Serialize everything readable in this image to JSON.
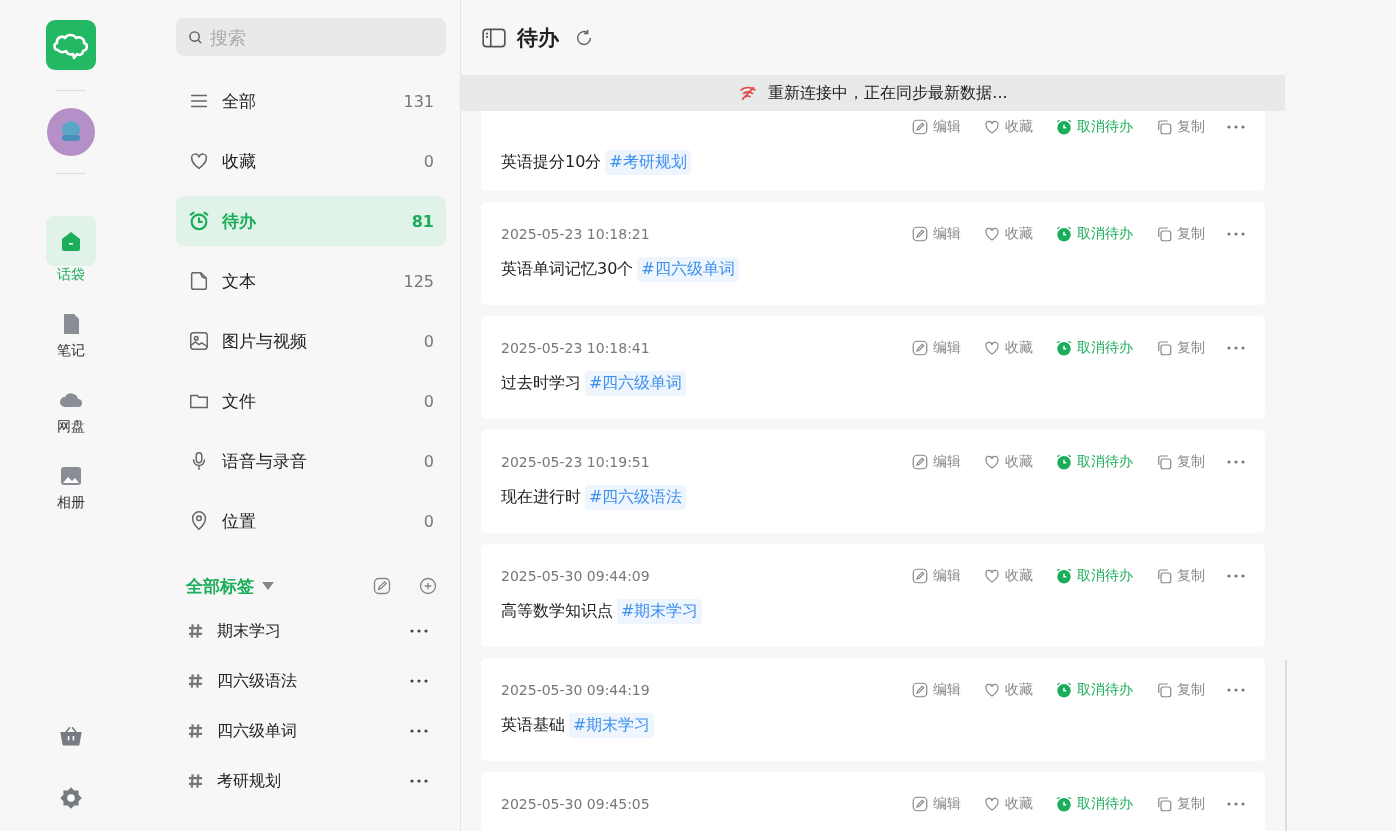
{
  "rail": {
    "items": [
      {
        "label": "话袋",
        "selected": true
      },
      {
        "label": "笔记",
        "selected": false
      },
      {
        "label": "网盘",
        "selected": false
      },
      {
        "label": "相册",
        "selected": false
      }
    ]
  },
  "sidebar": {
    "search": {
      "placeholder": "搜索"
    },
    "categories": [
      {
        "label": "全部",
        "count": "131",
        "selected": false
      },
      {
        "label": "收藏",
        "count": "0",
        "selected": false
      },
      {
        "label": "待办",
        "count": "81",
        "selected": true
      },
      {
        "label": "文本",
        "count": "125",
        "selected": false
      },
      {
        "label": "图片与视频",
        "count": "0",
        "selected": false
      },
      {
        "label": "文件",
        "count": "0",
        "selected": false
      },
      {
        "label": "语音与录音",
        "count": "0",
        "selected": false
      },
      {
        "label": "位置",
        "count": "0",
        "selected": false
      }
    ],
    "tags_header": {
      "label": "全部标签",
      "expanded": true
    },
    "tags": [
      {
        "name": "期末学习"
      },
      {
        "name": "四六级语法"
      },
      {
        "name": "四六级单词"
      },
      {
        "name": "考研规划"
      }
    ]
  },
  "main": {
    "title": "待办",
    "banner": {
      "text": "重新连接中，正在同步最新数据..."
    },
    "notes": [
      {
        "actions": [
          "编辑",
          "收藏",
          "取消待办",
          "复制"
        ],
        "text": "英语提分10分",
        "tag": "#考研规划"
      },
      {
        "date": "2025-05-23 10:18:21",
        "actions": [
          "编辑",
          "收藏",
          "取消待办",
          "复制"
        ],
        "text": "英语单词记忆30个",
        "tag": "#四六级单词"
      },
      {
        "date": "2025-05-23 10:18:41",
        "actions": [
          "编辑",
          "收藏",
          "取消待办",
          "复制"
        ],
        "text": "过去时学习",
        "tag": "#四六级单词"
      },
      {
        "date": "2025-05-23 10:19:51",
        "actions": [
          "编辑",
          "收藏",
          "取消待办",
          "复制"
        ],
        "text": "现在进行时",
        "tag": "#四六级语法"
      },
      {
        "date": "2025-05-30 09:44:09",
        "actions": [
          "编辑",
          "收藏",
          "取消待办",
          "复制"
        ],
        "text": "高等数学知识点",
        "tag": "#期末学习"
      },
      {
        "date": "2025-05-30 09:44:19",
        "actions": [
          "编辑",
          "收藏",
          "取消待办",
          "复制"
        ],
        "text": "英语基础",
        "tag": "#期末学习"
      },
      {
        "date": "2025-05-30 09:45:05",
        "actions": [
          "编辑",
          "收藏",
          "取消待办",
          "复制"
        ]
      }
    ]
  }
}
